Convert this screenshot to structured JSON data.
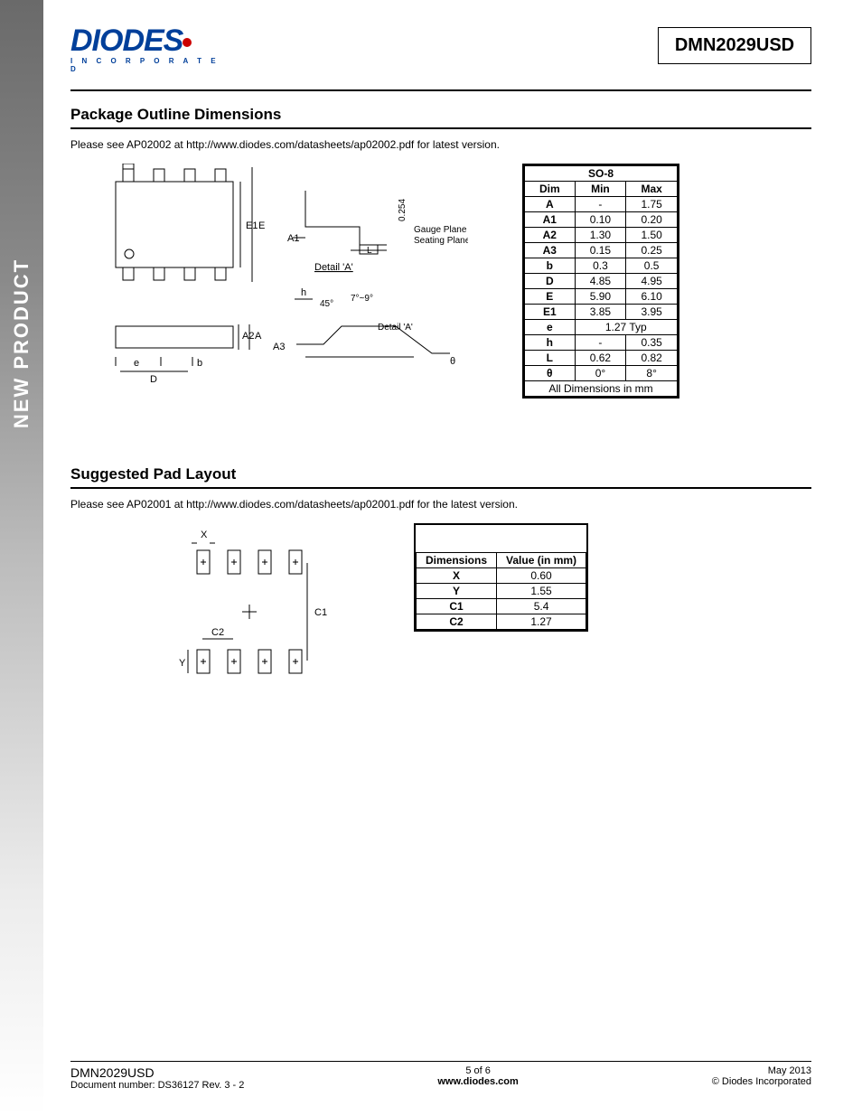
{
  "sidebar_label": "NEW PRODUCT",
  "logo": {
    "main": "DIODES",
    "sub": "I N C O R P O R A T E D"
  },
  "part_number": "DMN2029USD",
  "section1": {
    "title": "Package Outline Dimensions",
    "note": "Please see AP02002 at http://www.diodes.com/datasheets/ap02002.pdf for latest version.",
    "table_title": "SO-8",
    "headers": [
      "Dim",
      "Min",
      "Max"
    ],
    "rows": [
      {
        "dim": "A",
        "min": "-",
        "max": "1.75"
      },
      {
        "dim": "A1",
        "min": "0.10",
        "max": "0.20"
      },
      {
        "dim": "A2",
        "min": "1.30",
        "max": "1.50"
      },
      {
        "dim": "A3",
        "min": "0.15",
        "max": "0.25"
      },
      {
        "dim": "b",
        "min": "0.3",
        "max": "0.5"
      },
      {
        "dim": "D",
        "min": "4.85",
        "max": "4.95"
      },
      {
        "dim": "E",
        "min": "5.90",
        "max": "6.10"
      },
      {
        "dim": "E1",
        "min": "3.85",
        "max": "3.95"
      },
      {
        "dim": "e",
        "span": "1.27 Typ"
      },
      {
        "dim": "h",
        "min": "-",
        "max": "0.35"
      },
      {
        "dim": "L",
        "min": "0.62",
        "max": "0.82"
      },
      {
        "dim": "θ",
        "min": "0°",
        "max": "8°"
      }
    ],
    "table_footer": "All Dimensions in mm",
    "fig_labels": {
      "E1": "E1",
      "E": "E",
      "A1": "A1",
      "L": "L",
      "detail": "Detail 'A'",
      "gp": "Gauge Plane",
      "sp": "Seating Plane",
      "v": "0.254",
      "e": "e",
      "b": "b",
      "D": "D",
      "A2": "A2",
      "A": "A",
      "A3": "A3",
      "h": "h",
      "ang45": "45°",
      "ang79": "7°~9°",
      "detail2": "Detail 'A'",
      "theta": "θ"
    }
  },
  "section2": {
    "title": "Suggested Pad Layout",
    "note": "Please see AP02001 at http://www.diodes.com/datasheets/ap02001.pdf for the latest version.",
    "headers": [
      "Dimensions",
      "Value (in mm)"
    ],
    "rows": [
      {
        "dim": "X",
        "val": "0.60"
      },
      {
        "dim": "Y",
        "val": "1.55"
      },
      {
        "dim": "C1",
        "val": "5.4"
      },
      {
        "dim": "C2",
        "val": "1.27"
      }
    ],
    "fig_labels": {
      "X": "X",
      "Y": "Y",
      "C1": "C1",
      "C2": "C2"
    }
  },
  "footer": {
    "left1": "DMN2029USD",
    "left2": "Document number: DS36127  Rev. 3 - 2",
    "mid1": "5 of 6",
    "mid2": "www.diodes.com",
    "right1": "May 2013",
    "right2": "© Diodes Incorporated"
  }
}
